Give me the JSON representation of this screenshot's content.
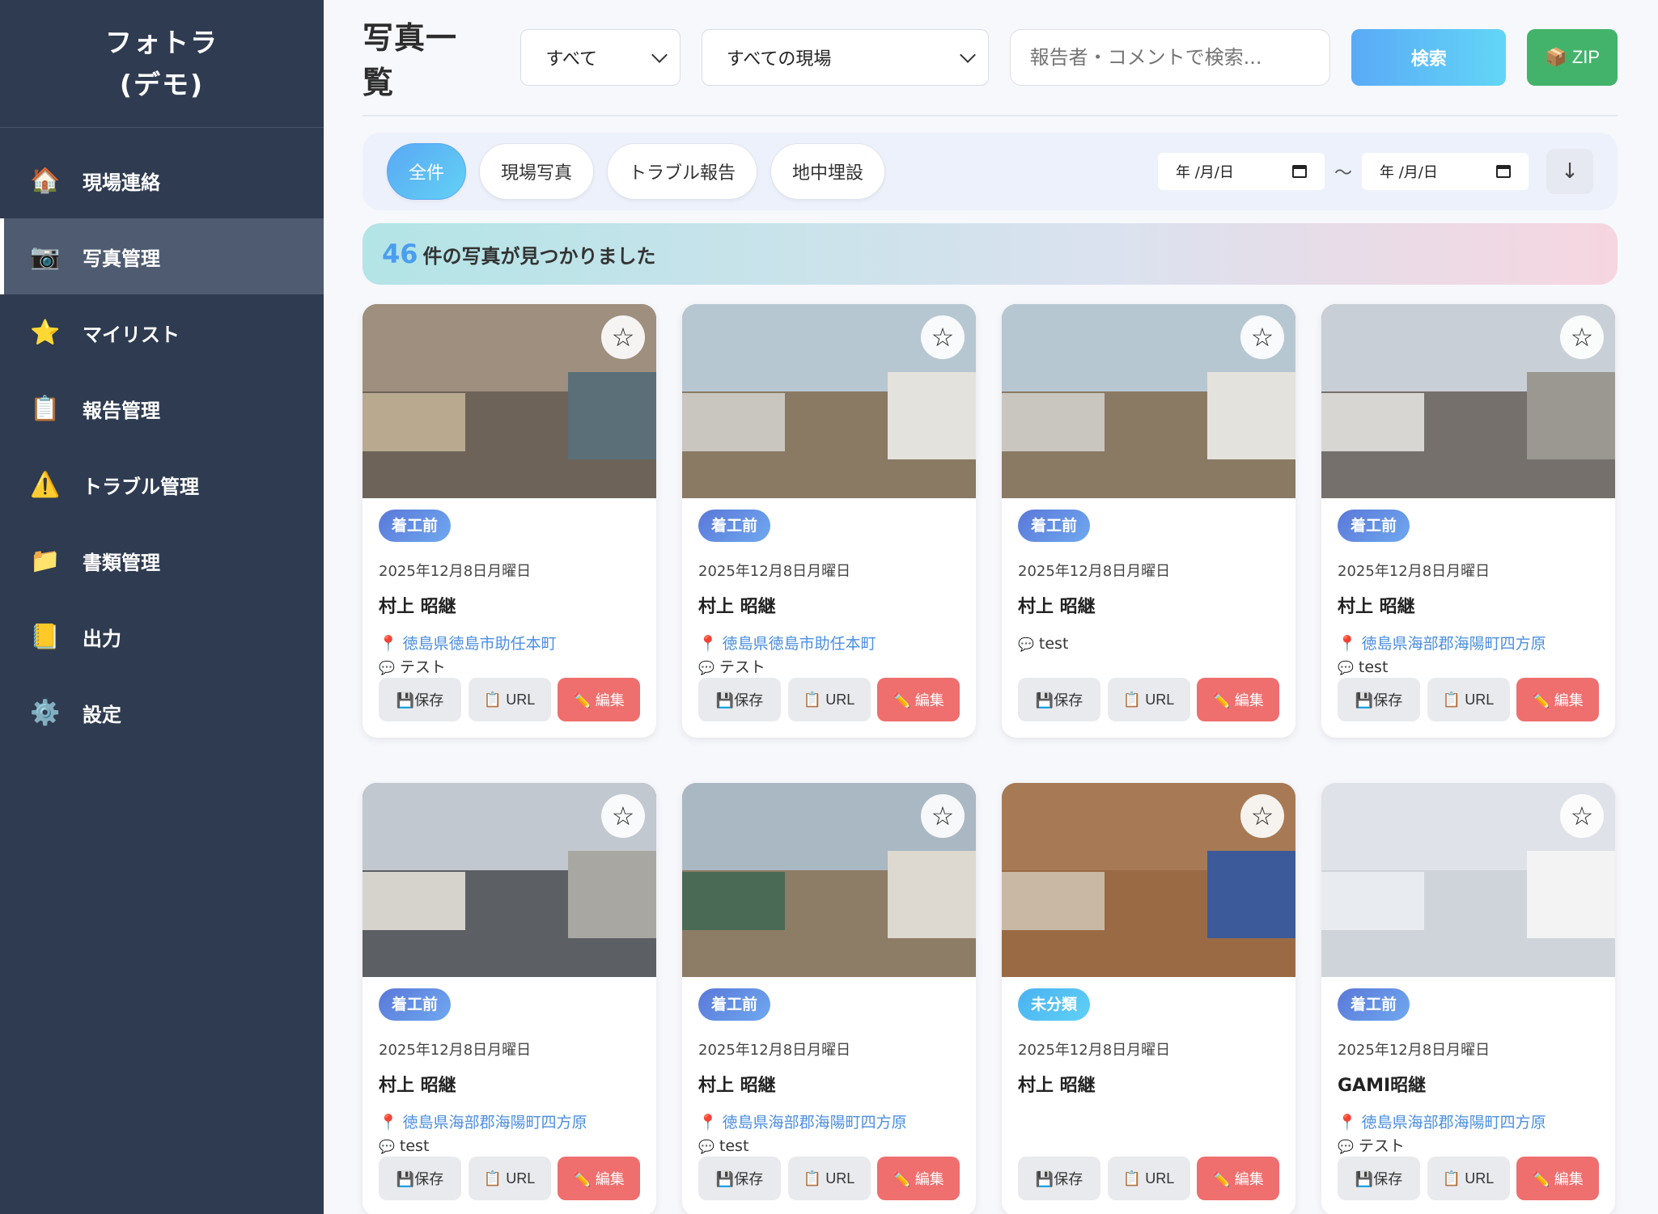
{
  "brand": {
    "line1": "フォトラ",
    "line2": "(デモ)"
  },
  "sidebar": {
    "items": [
      {
        "icon": "🏠",
        "label": "現場連絡",
        "name": "sidebar-item-site-contact",
        "iconName": "house-icon"
      },
      {
        "icon": "📷",
        "label": "写真管理",
        "name": "sidebar-item-photo-management",
        "iconName": "camera-icon",
        "active": true
      },
      {
        "icon": "⭐",
        "label": "マイリスト",
        "name": "sidebar-item-mylist",
        "iconName": "star-icon"
      },
      {
        "icon": "📋",
        "label": "報告管理",
        "name": "sidebar-item-reports",
        "iconName": "clipboard-icon"
      },
      {
        "icon": "⚠️",
        "label": "トラブル管理",
        "name": "sidebar-item-trouble",
        "iconName": "warning-icon"
      },
      {
        "icon": "📁",
        "label": "書類管理",
        "name": "sidebar-item-documents",
        "iconName": "folder-icon"
      },
      {
        "icon": "📒",
        "label": "出力",
        "name": "sidebar-item-output",
        "iconName": "notebook-icon"
      },
      {
        "icon": "⚙️",
        "label": "設定",
        "name": "sidebar-item-settings",
        "iconName": "gear-icon"
      }
    ]
  },
  "header": {
    "title": "写真一覧",
    "category_select": "すべて",
    "site_select": "すべての現場",
    "search_placeholder": "報告者・コメントで検索...",
    "search_button": "検索",
    "zip_button": "📦 ZIP"
  },
  "filters": {
    "chips": [
      "全件",
      "現場写真",
      "トラブル報告",
      "地中埋設"
    ],
    "active_chip": 0,
    "date_from": "年 /月/日",
    "date_to": "年 /月/日",
    "separator": "～",
    "sort_icon": "↓"
  },
  "result": {
    "count": "46",
    "suffix": "件の写真が見つかりました"
  },
  "labels": {
    "save": "💾保存",
    "url": "📋 URL",
    "edit": "✏️ 編集",
    "star": "☆"
  },
  "colors": {
    "sidebar": "#2f3b50",
    "accent": "#5aaaf6",
    "zip": "#43b36b",
    "edit": "#ef6e6e"
  },
  "cards": [
    {
      "tag": "着工前",
      "tag_type": "normal",
      "date": "2025年12月8日月曜日",
      "reporter": "村上 昭継",
      "location": "徳島県徳島市助任本町",
      "comment": "テスト",
      "photo": "debris"
    },
    {
      "tag": "着工前",
      "tag_type": "normal",
      "date": "2025年12月8日月曜日",
      "reporter": "村上 昭継",
      "location": "徳島県徳島市助任本町",
      "comment": "テスト",
      "photo": "lot"
    },
    {
      "tag": "着工前",
      "tag_type": "normal",
      "date": "2025年12月8日月曜日",
      "reporter": "村上 昭継",
      "location": "",
      "comment": "test",
      "photo": "lot"
    },
    {
      "tag": "着工前",
      "tag_type": "normal",
      "date": "2025年12月8日月曜日",
      "reporter": "村上 昭継",
      "location": "徳島県海部郡海陽町四方原",
      "comment": "test",
      "photo": "demolition"
    },
    {
      "tag": "着工前",
      "tag_type": "normal",
      "date": "2025年12月8日月曜日",
      "reporter": "村上 昭継",
      "location": "徳島県海部郡海陽町四方原",
      "comment": "test",
      "photo": "street"
    },
    {
      "tag": "着工前",
      "tag_type": "normal",
      "date": "2025年12月8日月曜日",
      "reporter": "村上 昭継",
      "location": "徳島県海部郡海陽町四方原",
      "comment": "test",
      "photo": "lot2"
    },
    {
      "tag": "未分類",
      "tag_type": "uncat",
      "date": "2025年12月8日月曜日",
      "reporter": "村上 昭継",
      "location": "",
      "comment": "",
      "photo": "soil"
    },
    {
      "tag": "着工前",
      "tag_type": "normal",
      "date": "2025年12月8日月曜日",
      "reporter": "GAMI昭継",
      "location": "徳島県海部郡海陽町四方原",
      "comment": "テスト",
      "photo": "screen"
    }
  ]
}
